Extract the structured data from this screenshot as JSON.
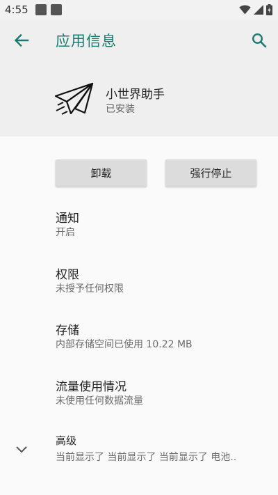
{
  "status_bar": {
    "time": "4:55"
  },
  "toolbar": {
    "title": "应用信息"
  },
  "app": {
    "name": "小世界助手",
    "status": "已安装"
  },
  "buttons": {
    "uninstall": "卸载",
    "force_stop": "强行停止"
  },
  "prefs": {
    "notifications": {
      "title": "通知",
      "summary": "开启"
    },
    "permissions": {
      "title": "权限",
      "summary": "未授予任何权限"
    },
    "storage": {
      "title": "存储",
      "summary": "内部存储空间已使用 10.22 MB"
    },
    "data_usage": {
      "title": "流量使用情况",
      "summary": "未使用任何数据流量"
    },
    "advanced": {
      "title": "高级",
      "summary": "当前显示了 当前显示了 当前显示了 电池.."
    }
  },
  "colors": {
    "accent": "#1a7a70",
    "header_bg": "#efefef",
    "page_bg": "#fafafa",
    "button_bg": "#dcdcdc"
  }
}
